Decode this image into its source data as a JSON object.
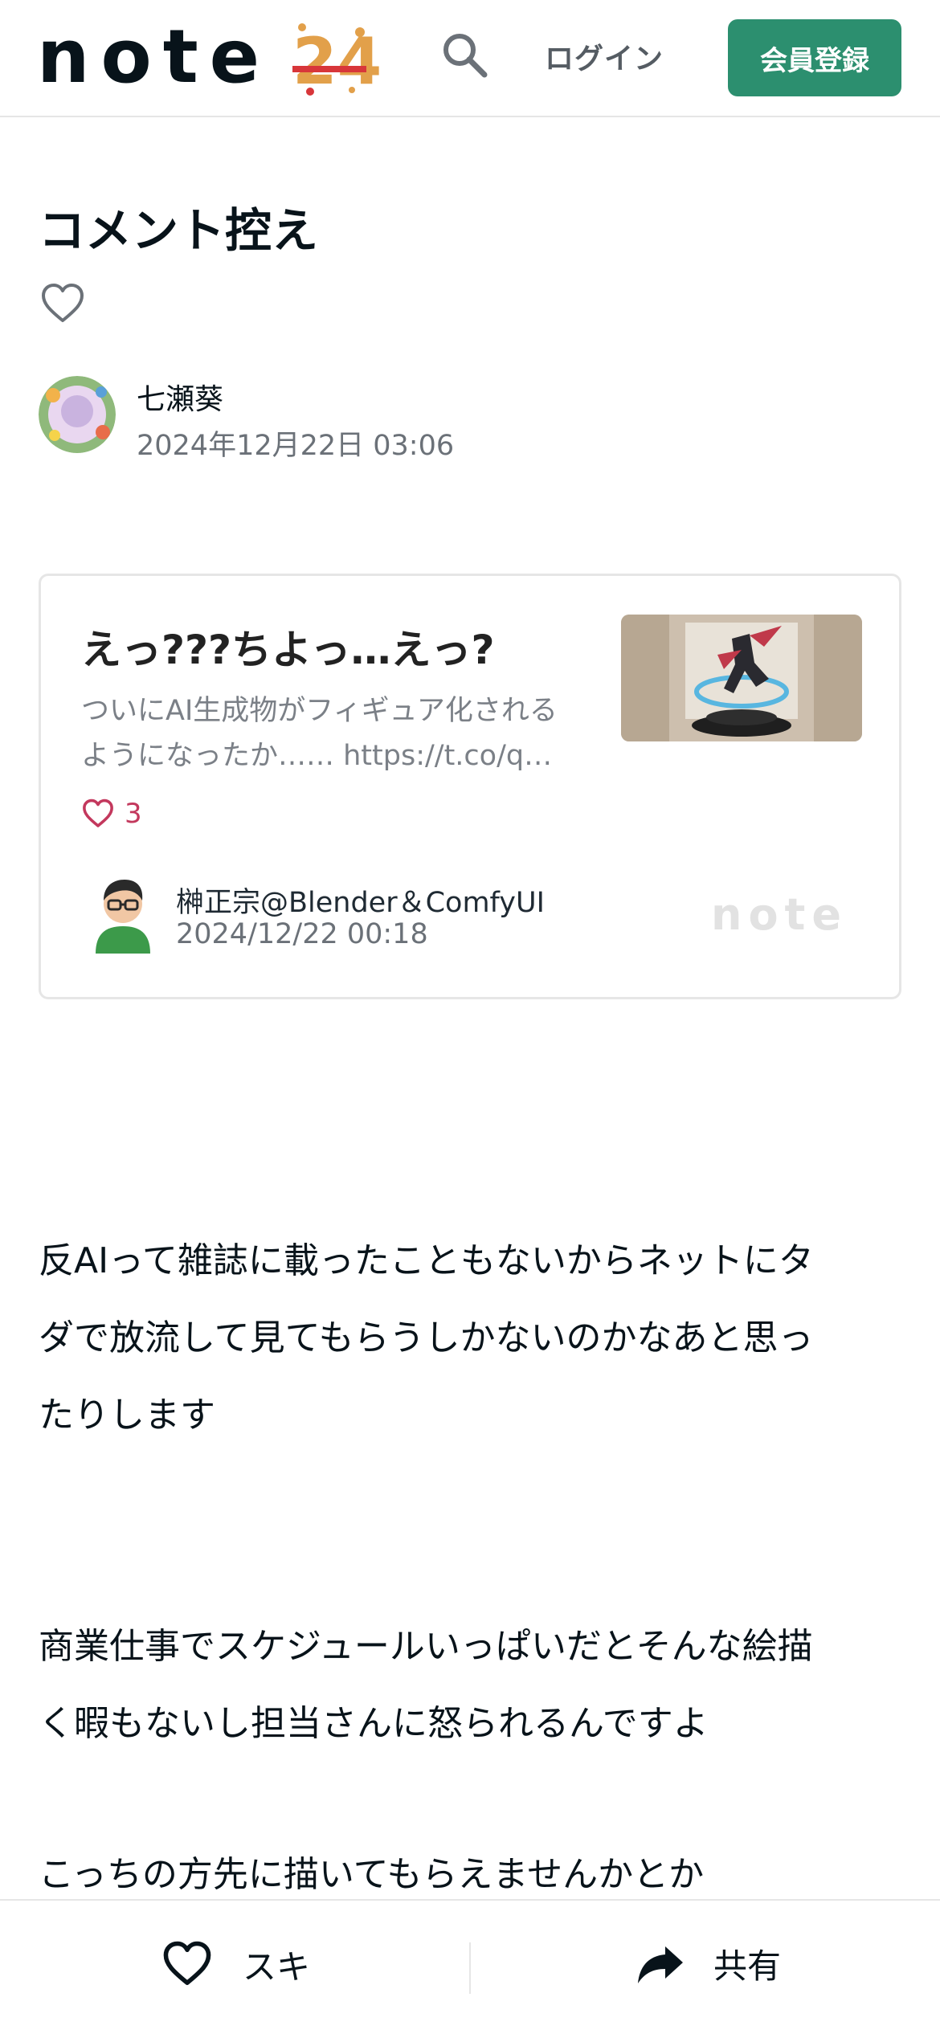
{
  "header": {
    "logo_text": "note",
    "logo_badge": "24",
    "login_label": "ログイン",
    "signup_label": "会員登録"
  },
  "article": {
    "title": "コメント控え",
    "author": "七瀬葵",
    "date": "2024年12月22日 03:06"
  },
  "embed": {
    "title": "えっ???ちよっ…えっ?",
    "desc_line1": "ついにAI生成物がフィギュア化される",
    "desc_line2": "ようになったか…… https://t.co/q…",
    "likes": "3",
    "author": "榊正宗@Blender＆ComfyUI",
    "date": "2024/12/22 00:18",
    "brand": "note"
  },
  "body": {
    "p1": [
      "反AIって雑誌に載ったこともないからネットにタ",
      "ダで放流して見てもらうしかないのかなあと思っ",
      "たりします"
    ],
    "p2": [
      "商業仕事でスケジュールいっぱいだとそんな絵描",
      "く暇もないし担当さんに怒られるんですよ"
    ],
    "p3": [
      "こっちの方先に描いてもらえませんかとか"
    ]
  },
  "bottom_bar": {
    "like_label": "スキ",
    "share_label": "共有"
  },
  "colors": {
    "brand_green": "#2c8f6f",
    "like_pink": "#c3385d",
    "logo_orange": "#e2a04a",
    "logo_red": "#d8363a"
  },
  "icons": [
    "search-icon",
    "heart-icon",
    "share-arrow-icon"
  ]
}
